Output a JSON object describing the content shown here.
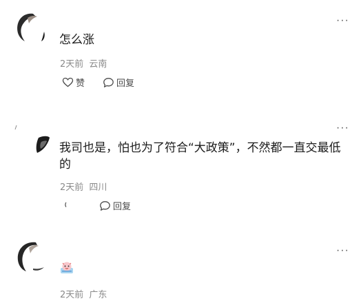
{
  "comments": [
    {
      "text": "怎么涨",
      "time": "2天前",
      "location": "云南",
      "like_label": "赞",
      "reply_label": "回复",
      "more_label": "···"
    },
    {
      "text": "我司也是，怕也为了符合“大政策”，不然都一直交最低的",
      "time": "2天前",
      "location": "四川",
      "reply_label": "回复",
      "more_label": "···"
    },
    {
      "time": "2天前",
      "location": "广东",
      "more_label": "···",
      "sticker_icon": "emoji-sticker-icon"
    }
  ]
}
